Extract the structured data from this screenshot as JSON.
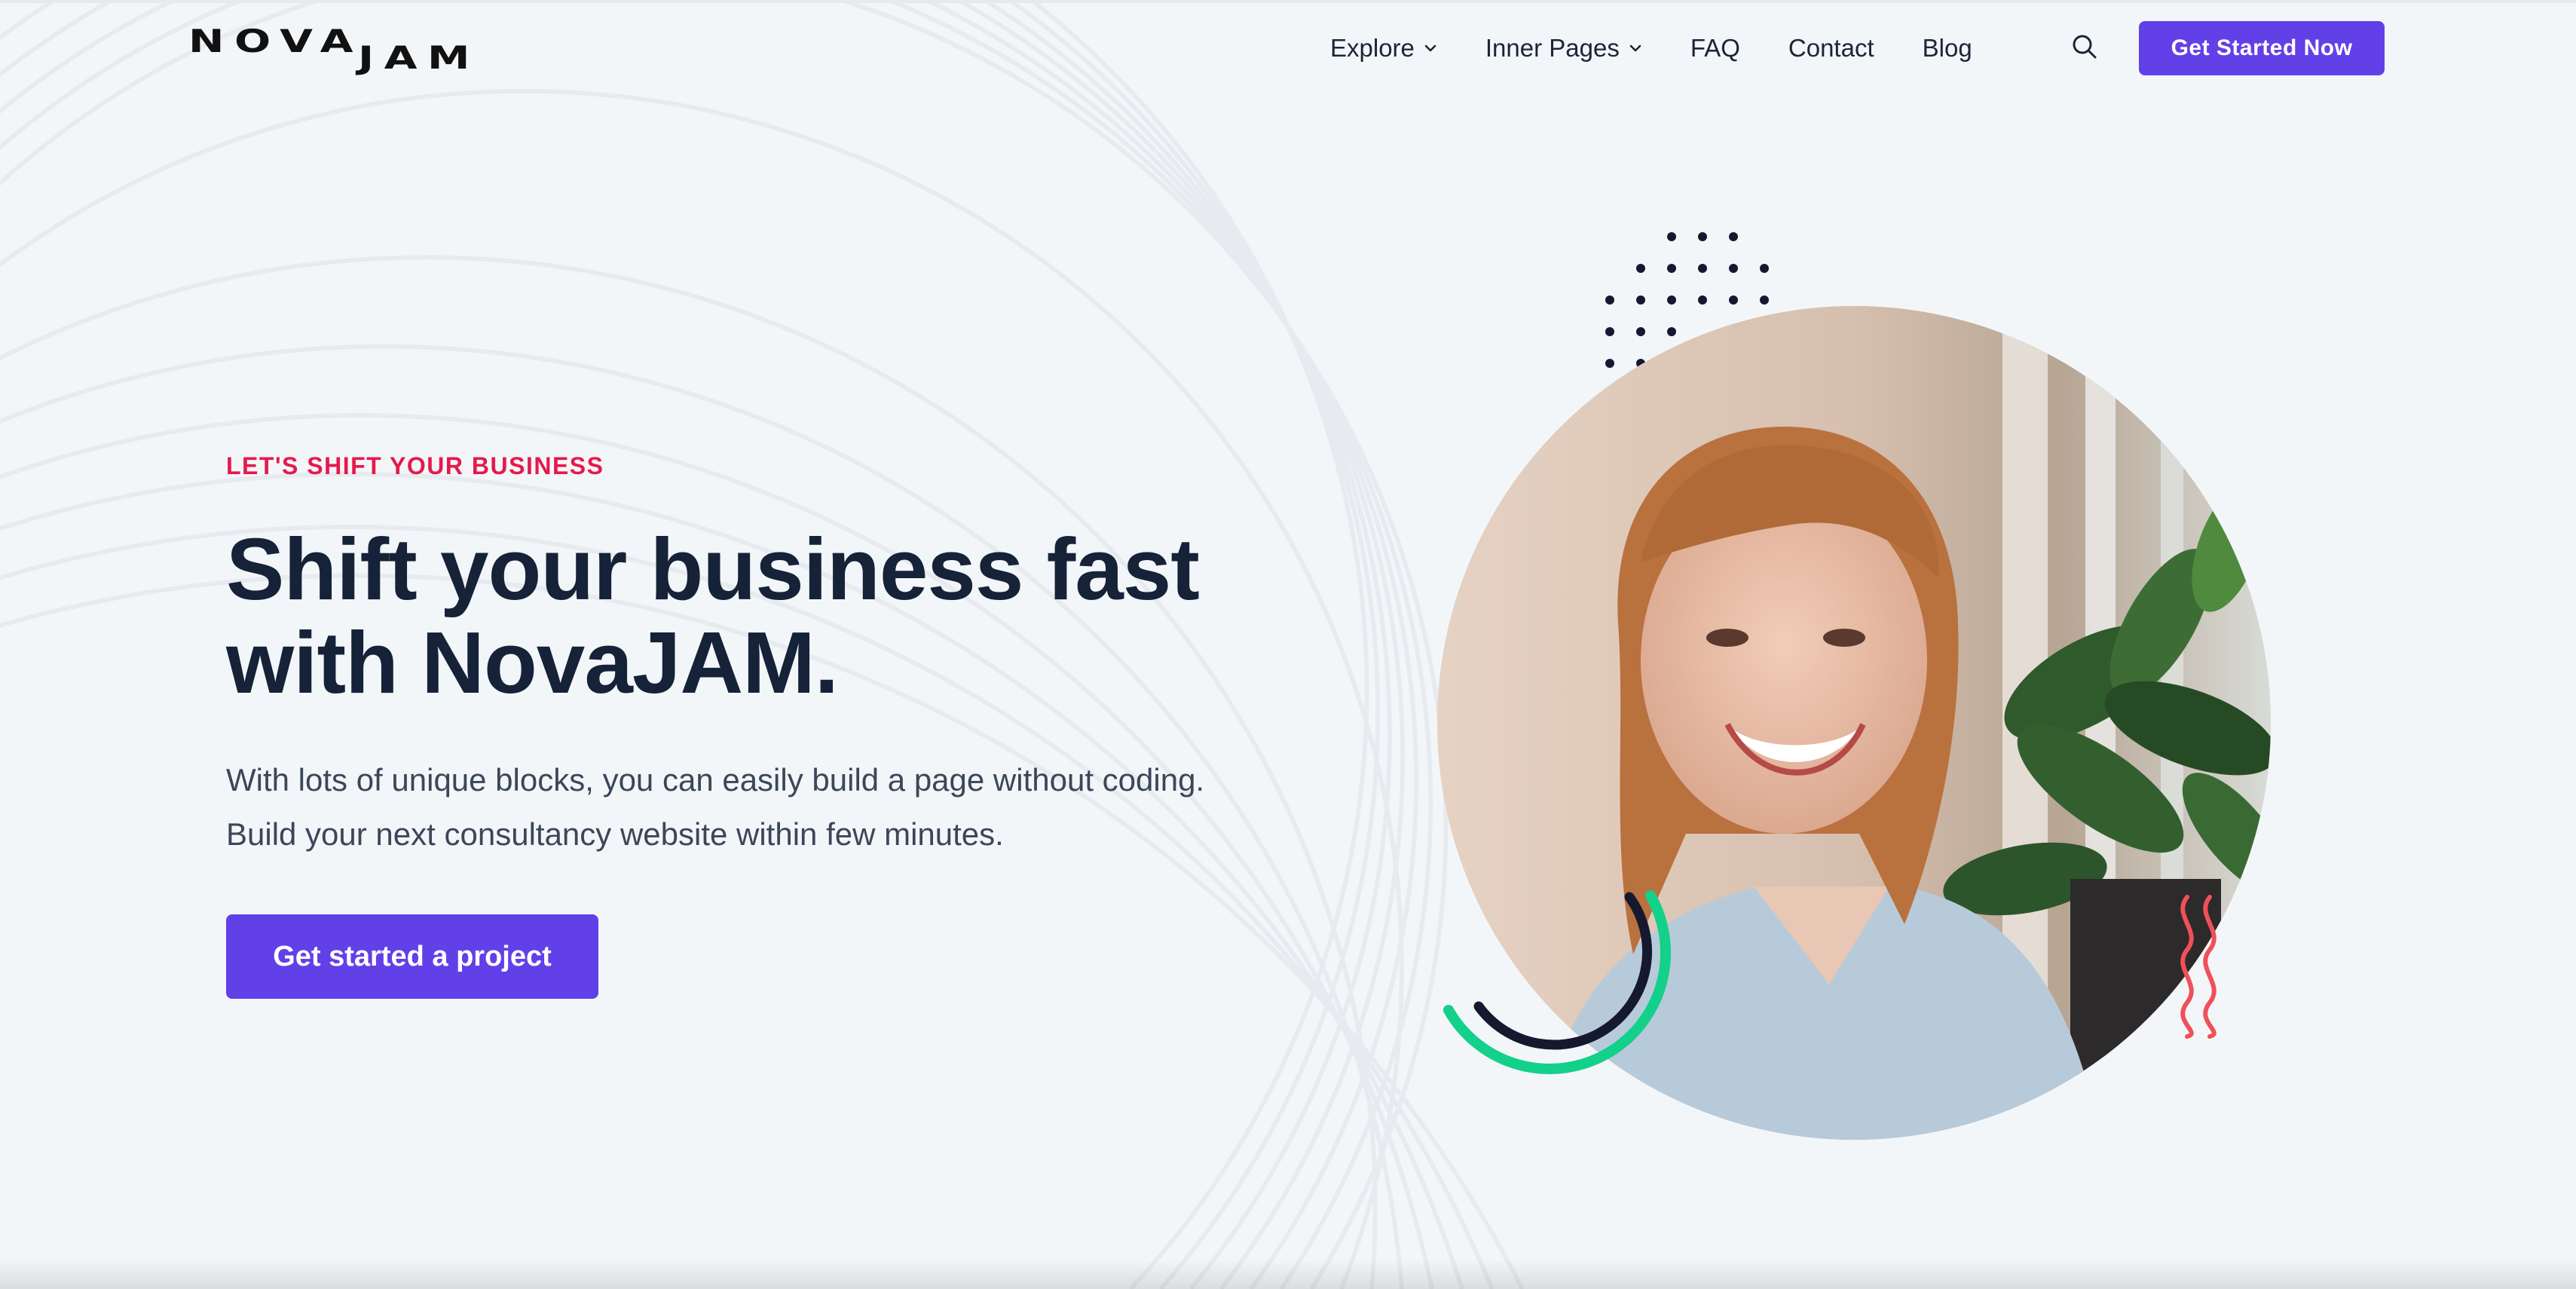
{
  "header": {
    "logo": {
      "word1": "NOVA",
      "word2": "JAM"
    },
    "nav": [
      {
        "label": "Explore",
        "has_dropdown": true
      },
      {
        "label": "Inner Pages",
        "has_dropdown": true
      },
      {
        "label": "FAQ",
        "has_dropdown": false
      },
      {
        "label": "Contact",
        "has_dropdown": false
      },
      {
        "label": "Blog",
        "has_dropdown": false
      }
    ],
    "search_icon": "search-icon",
    "cta_label": "Get Started Now"
  },
  "hero": {
    "eyebrow": "LET'S SHIFT YOUR BUSINESS",
    "headline_line1": "Shift your business fast",
    "headline_line2": "with NovaJAM.",
    "lead": "With lots of unique blocks, you can easily build a page without coding. Build your next consultancy website within few minutes.",
    "cta_label": "Get started a project"
  },
  "visual": {
    "photo_subject": "smiling woman with red hair and a houseplant",
    "decorations": [
      "dot-grid",
      "green-arc",
      "navy-arc",
      "red-squiggles"
    ]
  },
  "colors": {
    "accent": "#6240e8",
    "eyebrow": "#e6194b",
    "heading": "#152238",
    "body_text": "#3b4758",
    "background": "#f3f6f9",
    "green_arc": "#13d08a",
    "squiggle": "#f0505a",
    "dot": "#15192f"
  }
}
